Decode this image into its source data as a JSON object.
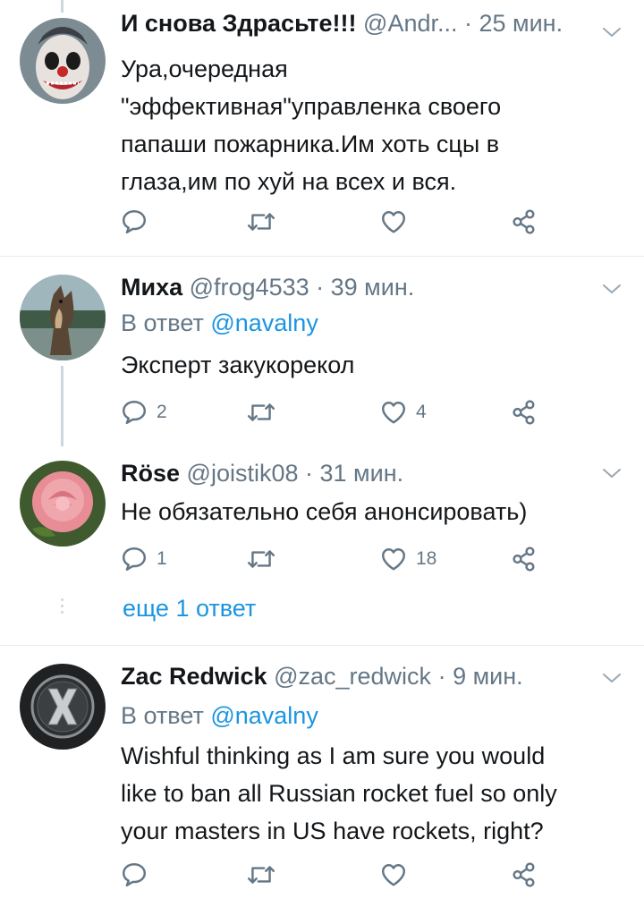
{
  "colors": {
    "accent": "#1b95e0",
    "meta": "#657786",
    "text": "#14171a",
    "divider": "#e6ecf0"
  },
  "tweets": [
    {
      "name": "И снова Здрасьте!!!",
      "handle": "@Andr...",
      "time": "· 25 мин.",
      "text_lines": [
        "Ура,очередная",
        "\"эффективная\"управленка своего",
        "папаши пожарника.Им хоть сцы в",
        "глаза,им по хуй на всех и вся."
      ],
      "reply_count": "",
      "retweet_count": "",
      "like_count": ""
    },
    {
      "name": "Миха",
      "handle": "@frog4533",
      "time": "· 39 мин.",
      "reply_prefix": "В ответ",
      "reply_mention": "@navalny",
      "text_lines": [
        "Эксперт закукорекол"
      ],
      "reply_count": "2",
      "retweet_count": "",
      "like_count": "4"
    },
    {
      "name": "Röse",
      "handle": "@joistik08",
      "time": "· 31 мин.",
      "text_lines": [
        "Не обязательно себя анонсировать)"
      ],
      "reply_count": "1",
      "retweet_count": "",
      "like_count": "18",
      "more_replies": "еще 1 ответ"
    },
    {
      "name": "Zac Redwick",
      "handle": "@zac_redwick",
      "time": "· 9 мин.",
      "reply_prefix": "В ответ",
      "reply_mention": "@navalny",
      "text_lines": [
        "Wishful thinking as I am sure you would",
        "like to ban all Russian rocket fuel so only",
        "your masters in US have rockets, right?"
      ],
      "reply_count": "",
      "retweet_count": "",
      "like_count": ""
    }
  ]
}
